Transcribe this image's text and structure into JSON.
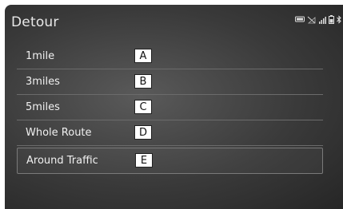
{
  "screen": {
    "title": "Detour"
  },
  "status_icons": [
    "phone-icon",
    "no-signal-icon",
    "signal-bars-icon",
    "battery-icon",
    "bluetooth-icon"
  ],
  "options": [
    {
      "label": "1mile",
      "callout": "A"
    },
    {
      "label": "3miles",
      "callout": "B"
    },
    {
      "label": "5miles",
      "callout": "C"
    },
    {
      "label": "Whole Route",
      "callout": "D"
    },
    {
      "label": "Around Traffic",
      "callout": "E"
    }
  ]
}
